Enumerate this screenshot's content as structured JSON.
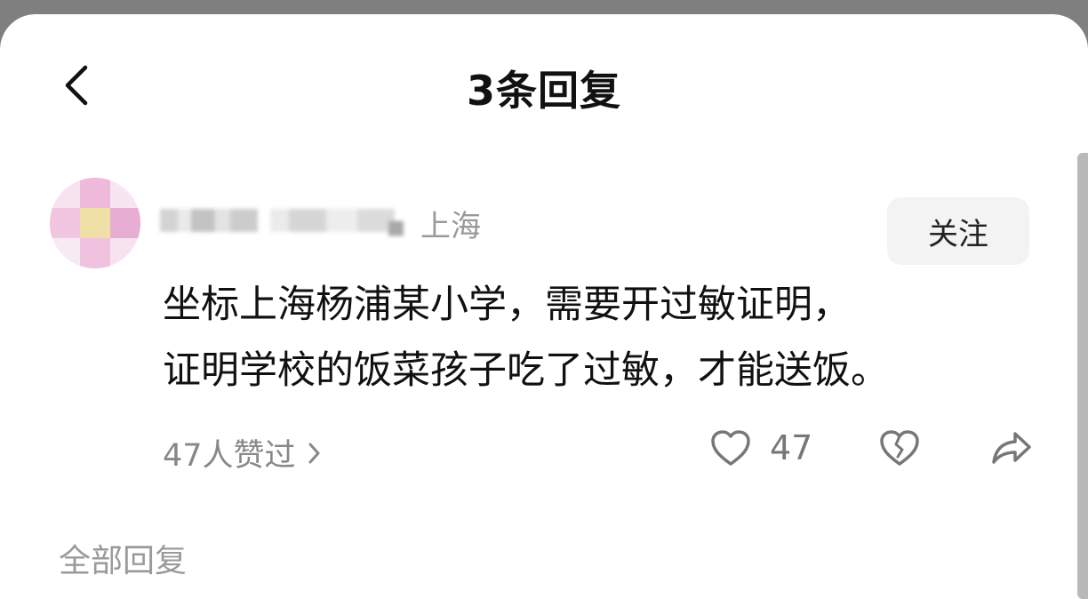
{
  "header": {
    "title": "3条回复",
    "back_icon": "chevron-left-icon"
  },
  "reply": {
    "location": "上海",
    "follow_label": "关注",
    "text": "坐标上海杨浦某小学，需要开过敏证明，\n证明学校的饭菜孩子吃了过敏，才能送饭。",
    "likes_link": "47人赞过",
    "like_count": "47",
    "icons": {
      "like": "heart-outline-icon",
      "dislike": "broken-heart-icon",
      "share": "share-arrow-icon",
      "more": "chevron-right-icon"
    }
  },
  "section": {
    "all_replies_label": "全部回复"
  },
  "colors": {
    "overlay": "#7f7f7f",
    "sheet": "#ffffff",
    "primary_text": "#111111",
    "secondary_text": "#888888",
    "follow_bg": "#f3f3f3"
  }
}
